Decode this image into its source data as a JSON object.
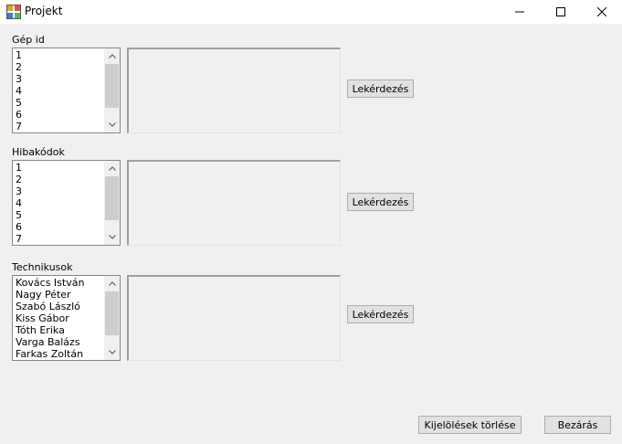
{
  "window": {
    "title": "Projekt"
  },
  "sections": [
    {
      "label": "Gép id",
      "items": [
        "1",
        "2",
        "3",
        "4",
        "5",
        "6",
        "7"
      ],
      "query_button": "Lekérdezés"
    },
    {
      "label": "Hibakódok",
      "items": [
        "1",
        "2",
        "3",
        "4",
        "5",
        "6",
        "7"
      ],
      "query_button": "Lekérdezés"
    },
    {
      "label": "Technikusok",
      "items": [
        "Kovács István",
        "Nagy Péter",
        "Szabó László",
        "Kiss Gábor",
        "Tóth Erika",
        "Varga Balázs",
        "Farkas Zoltán"
      ],
      "query_button": "Lekérdezés"
    }
  ],
  "footer": {
    "clear_label": "Kijelölések törlése",
    "close_label": "Bezárás"
  }
}
